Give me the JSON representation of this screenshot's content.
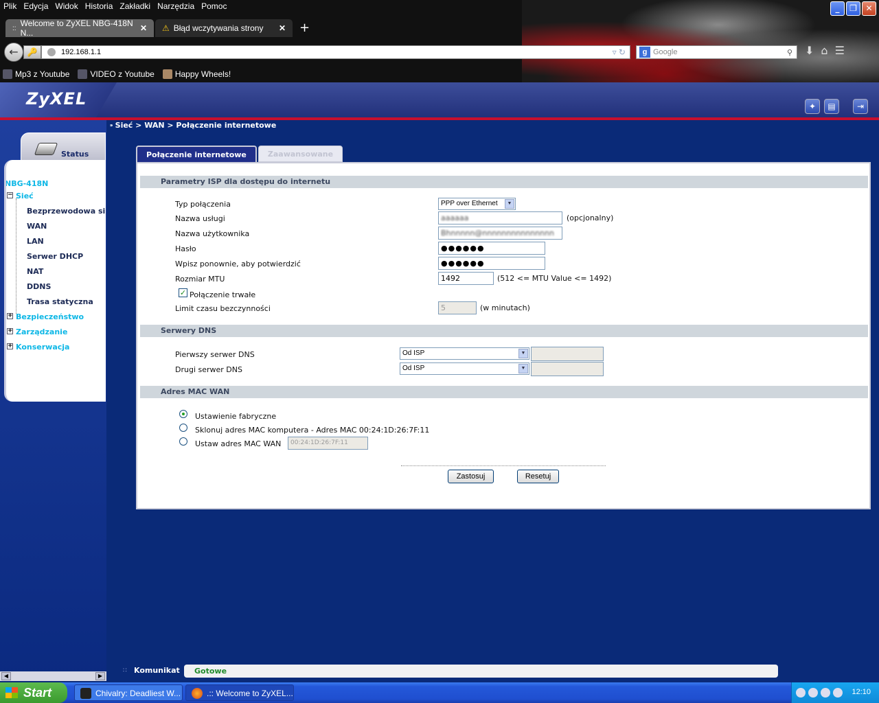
{
  "browser": {
    "menu": [
      "Plik",
      "Edycja",
      "Widok",
      "Historia",
      "Zakładki",
      "Narzędzia",
      "Pomoc"
    ],
    "tabs": [
      {
        "label": "Welcome to ZyXEL NBG-418N N...",
        "icon": "zyxel-favicon-icon",
        "active": true
      },
      {
        "label": "Błąd wczytywania strony",
        "icon": "warning-icon",
        "active": false
      }
    ],
    "url": "192.168.1.1",
    "search_placeholder": "Google",
    "bookmarks": [
      {
        "label": "Mp3 z Youtube",
        "icon": "youtube-mp3-icon"
      },
      {
        "label": "VIDEO z Youtube",
        "icon": "video-download-icon"
      },
      {
        "label": "Happy Wheels!",
        "icon": "game-icon"
      }
    ]
  },
  "app": {
    "logo": "ZyXEL",
    "breadcrumb": "Sieć > WAN > Połączenie internetowe",
    "header_icons": [
      "wizard-icon",
      "help-icon",
      "logout-icon"
    ]
  },
  "nav": {
    "status_label": "Status",
    "model": "NBG-418N",
    "items": [
      {
        "label": "Sieć",
        "level": 0,
        "expanded": true
      },
      {
        "label": "Bezprzewodowa si",
        "level": 1
      },
      {
        "label": "WAN",
        "level": 1
      },
      {
        "label": "LAN",
        "level": 1
      },
      {
        "label": "Serwer DHCP",
        "level": 1
      },
      {
        "label": "NAT",
        "level": 1
      },
      {
        "label": "DDNS",
        "level": 1
      },
      {
        "label": "Trasa statyczna",
        "level": 1
      },
      {
        "label": "Bezpieczeństwo",
        "level": 0,
        "expanded": false
      },
      {
        "label": "Zarządzanie",
        "level": 0,
        "expanded": false
      },
      {
        "label": "Konserwacja",
        "level": 0,
        "expanded": false
      }
    ]
  },
  "content_tabs": [
    {
      "label": "Połączenie internetowe",
      "active": true
    },
    {
      "label": "Zaawansowane",
      "active": false
    }
  ],
  "isp": {
    "section_title": "Parametry ISP dla dostępu do internetu",
    "connection_type_label": "Typ połączenia",
    "connection_type_value": "PPP over Ethernet",
    "service_name_label": "Nazwa usługi",
    "service_name_value": "aaaaaa",
    "service_name_note": "(opcjonalny)",
    "username_label": "Nazwa użytkownika",
    "username_value": "Bhnnnnn@nnnnnnnnnnnnnnn",
    "password_label": "Hasło",
    "password_value": "●●●●●●",
    "confirm_label": "Wpisz ponownie, aby potwierdzić",
    "confirm_value": "●●●●●●",
    "mtu_label": "Rozmiar MTU",
    "mtu_value": "1492",
    "mtu_note": "(512 <= MTU Value <= 1492)",
    "persistent_label": "Połączenie trwałe",
    "persistent_checked": true,
    "idle_label": "Limit czasu bezczynności",
    "idle_value": "5",
    "idle_note": "(w minutach)"
  },
  "dns": {
    "section_title": "Serwery DNS",
    "first_label": "Pierwszy serwer DNS",
    "first_value": "Od ISP",
    "second_label": "Drugi serwer DNS",
    "second_value": "Od ISP"
  },
  "mac": {
    "section_title": "Adres MAC WAN",
    "factory_label": "Ustawienie fabryczne",
    "clone_label": "Sklonuj adres MAC komputera - Adres MAC 00:24:1D:26:7F:11",
    "set_label": "Ustaw adres MAC WAN",
    "set_value": "00:24:1D:26:7F:11",
    "selected": "factory"
  },
  "buttons": {
    "apply": "Zastosuj",
    "reset": "Resetuj"
  },
  "statusbar": {
    "label": "Komunikat",
    "value": "Gotowe"
  },
  "taskbar": {
    "start": "Start",
    "tasks": [
      {
        "label": "Chivalry: Deadliest W...",
        "icon": "chivalry-shield-icon"
      },
      {
        "label": ".:: Welcome to ZyXEL...",
        "icon": "firefox-icon"
      }
    ],
    "clock": "12:10"
  }
}
